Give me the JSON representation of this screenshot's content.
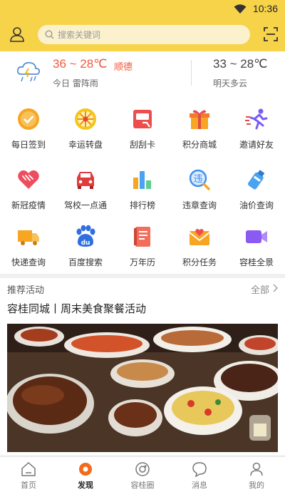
{
  "status_bar": {
    "time": "10:36",
    "wifi_icon": "wifi-icon"
  },
  "header": {
    "user_icon": "user-icon",
    "search": {
      "placeholder": "搜索关键词",
      "icon": "search-icon"
    },
    "scan_icon": "scan-icon"
  },
  "weather": {
    "today_temp": "36 ~ 28℃",
    "city": "顺德",
    "today_desc": "今日 雷阵雨",
    "tomorrow_temp": "33 ~ 28℃",
    "tomorrow_desc": "明天多云",
    "icon": "thunderstorm-icon"
  },
  "grid": {
    "items": [
      {
        "label": "每日签到",
        "icon": "check-in-icon",
        "color": "#f6a623"
      },
      {
        "label": "幸运转盘",
        "icon": "lucky-wheel-icon",
        "color": "#f5c518"
      },
      {
        "label": "刮刮卡",
        "icon": "scratch-card-icon",
        "color": "#ee4d4d"
      },
      {
        "label": "积分商城",
        "icon": "gift-icon",
        "color": "#f5a623"
      },
      {
        "label": "邀请好友",
        "icon": "running-person-icon",
        "color": "#7a5af8"
      },
      {
        "label": "新冠疫情",
        "icon": "heart-icon",
        "color": "#ee4d5f"
      },
      {
        "label": "驾校一点通",
        "icon": "car-icon",
        "color": "#e23b3b"
      },
      {
        "label": "排行榜",
        "icon": "bar-chart-icon",
        "color": "#4aa3f0"
      },
      {
        "label": "违章查询",
        "icon": "violation-query-icon",
        "color": "#3f8ef0"
      },
      {
        "label": "油价查询",
        "icon": "gas-bottle-icon",
        "color": "#4aa3f0"
      },
      {
        "label": "快递查询",
        "icon": "delivery-truck-icon",
        "color": "#f6a623"
      },
      {
        "label": "百度搜索",
        "icon": "baidu-paw-icon",
        "color": "#2f6fe0"
      },
      {
        "label": "万年历",
        "icon": "calendar-book-icon",
        "color": "#f26d5b"
      },
      {
        "label": "积分任务",
        "icon": "envelope-heart-icon",
        "color": "#f6a623"
      },
      {
        "label": "容桂全景",
        "icon": "video-camera-icon",
        "color": "#8a5af2"
      }
    ]
  },
  "activity": {
    "section_title": "推荐活动",
    "more_label": "全部",
    "title": "容桂同城丨周末美食聚餐活动",
    "image_alt": "food-table-photo"
  },
  "tabbar": {
    "tabs": [
      {
        "label": "首页",
        "icon": "home-icon",
        "active": false
      },
      {
        "label": "发现",
        "icon": "discover-icon",
        "active": true
      },
      {
        "label": "容桂圈",
        "icon": "circle-icon",
        "active": false
      },
      {
        "label": "消息",
        "icon": "message-icon",
        "active": false
      },
      {
        "label": "我的",
        "icon": "profile-icon",
        "active": false
      }
    ]
  },
  "colors": {
    "brand": "#f7d34a",
    "accent": "#f05a3c",
    "active_tab": "#f26a1b"
  }
}
